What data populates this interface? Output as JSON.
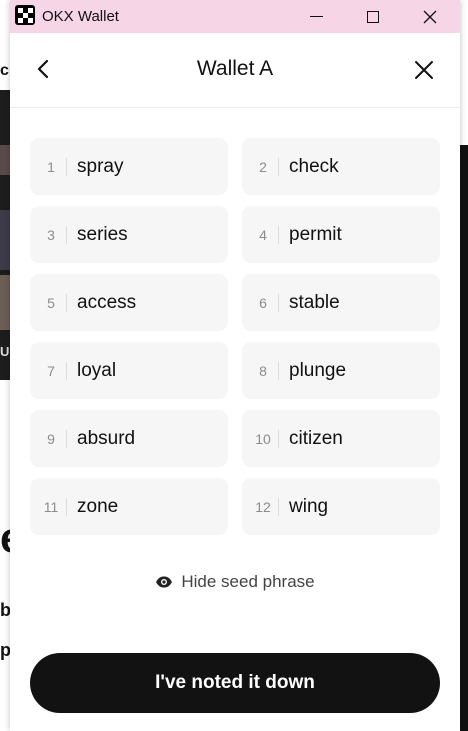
{
  "window": {
    "app_title": "OKX Wallet"
  },
  "header": {
    "title": "Wallet A"
  },
  "seed_words": [
    {
      "index": "1",
      "word": "spray"
    },
    {
      "index": "2",
      "word": "check"
    },
    {
      "index": "3",
      "word": "series"
    },
    {
      "index": "4",
      "word": "permit"
    },
    {
      "index": "5",
      "word": "access"
    },
    {
      "index": "6",
      "word": "stable"
    },
    {
      "index": "7",
      "word": "loyal"
    },
    {
      "index": "8",
      "word": "plunge"
    },
    {
      "index": "9",
      "word": "absurd"
    },
    {
      "index": "10",
      "word": "citizen"
    },
    {
      "index": "11",
      "word": "zone"
    },
    {
      "index": "12",
      "word": "wing"
    }
  ],
  "actions": {
    "hide_label": "Hide seed phrase",
    "hide_icon": "eye-icon",
    "primary_label": "I've noted it down"
  },
  "background_fragments": {
    "a": "ch",
    "b": "U",
    "c": "e",
    "d": "b",
    "e": "p"
  },
  "colors": {
    "titlebar": "#f5d5e6",
    "primary_button": "#121212",
    "cell_bg": "#f6f6f6"
  }
}
